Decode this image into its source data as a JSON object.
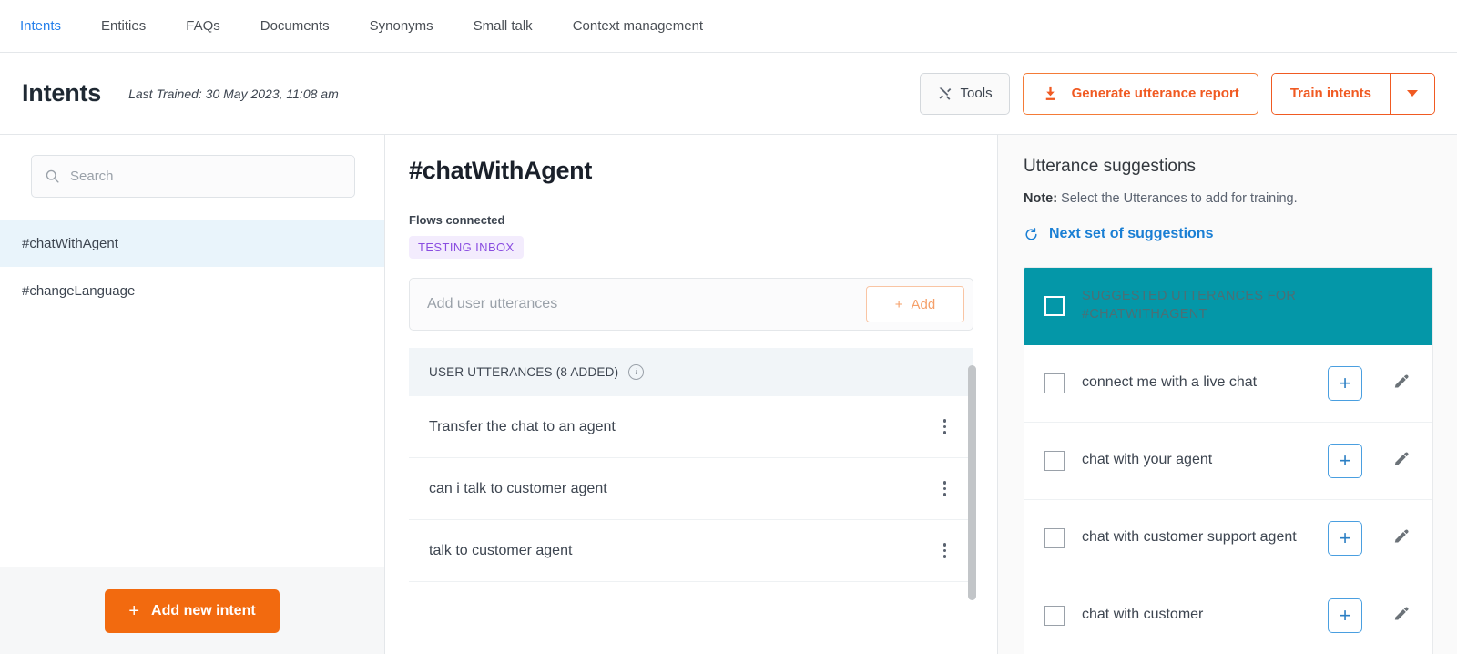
{
  "topnav": {
    "items": [
      {
        "label": "Intents",
        "active": true
      },
      {
        "label": "Entities",
        "active": false
      },
      {
        "label": "FAQs",
        "active": false
      },
      {
        "label": "Documents",
        "active": false
      },
      {
        "label": "Synonyms",
        "active": false
      },
      {
        "label": "Small talk",
        "active": false
      },
      {
        "label": "Context management",
        "active": false
      }
    ]
  },
  "header": {
    "title": "Intents",
    "last_trained": "Last Trained: 30 May 2023, 11:08 am",
    "tools_label": "Tools",
    "tools_icon": "crossed-tools-icon",
    "generate_report_label": "Generate utterance report",
    "download_icon": "download-icon",
    "train_label": "Train intents",
    "caret_icon": "chevron-down-icon"
  },
  "sidebar": {
    "search_placeholder": "Search",
    "search_value": "",
    "search_icon": "search-icon",
    "intents": [
      {
        "label": "#chatWithAgent",
        "selected": true
      },
      {
        "label": "#changeLanguage",
        "selected": false
      }
    ],
    "add_intent_label": "Add new intent",
    "add_intent_plus": "+"
  },
  "main": {
    "intent_name": "#chatWithAgent",
    "flows_label": "Flows connected",
    "flow_chips": [
      "TESTING INBOX"
    ],
    "add_utterance_placeholder": "Add user utterances",
    "add_utterance_value": "",
    "add_button_label": "Add",
    "add_button_plus": "+",
    "utterances_header": "USER UTTERANCES (8 ADDED)",
    "info_icon": "info-icon",
    "utterances": [
      {
        "text": "Transfer the chat to an agent"
      },
      {
        "text": "can i talk to customer agent"
      },
      {
        "text": "talk to customer agent"
      }
    ],
    "kebab_icon": "more-vertical-icon"
  },
  "suggestions": {
    "title": "Utterance suggestions",
    "note_label": "Note:",
    "note_text": " Select the Utterances to add for training.",
    "next_set_label": "Next set of suggestions",
    "refresh_icon": "refresh-icon",
    "group_header": "SUGGESTED UTTERANCES FOR #CHATWITHAGENT",
    "group_checked": false,
    "items": [
      {
        "text": "connect me with a live chat",
        "checked": false
      },
      {
        "text": "chat with your agent",
        "checked": false
      },
      {
        "text": "chat with customer support agent",
        "checked": false
      },
      {
        "text": "chat with customer",
        "checked": false
      }
    ],
    "add_icon": "plus-icon",
    "edit_icon": "pencil-icon"
  },
  "colors": {
    "accent_orange": "#f26a0f",
    "link_blue": "#2680eb",
    "teal": "#0497a8",
    "chip_purple": "#8a4de0",
    "selected_row": "#e9f4fb"
  }
}
